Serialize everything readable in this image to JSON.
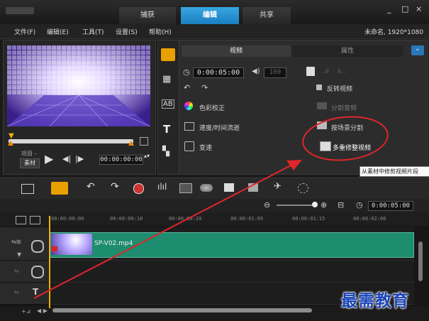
{
  "tabs": {
    "capture": "捕获",
    "edit": "编辑",
    "share": "共享"
  },
  "window_controls": {
    "minimize": "_",
    "maximize": "□",
    "close": "×"
  },
  "menu": [
    "文件(F)",
    "编辑(E)",
    "工具(T)",
    "设置(S)",
    "帮助(H)"
  ],
  "project_name": "未命名, 1920*1080",
  "preview": {
    "mode_project": "项目 -",
    "mode_clip": "素材",
    "timecode": "00:00:00:00"
  },
  "options_panel": {
    "tab_video": "视频",
    "tab_attribute": "属性",
    "duration": "0:00:05:00",
    "volume": "100",
    "items": {
      "color_correction": "色彩校正",
      "speed_time_lapse": "速度/时间流逝",
      "variable_speed": "变速",
      "reverse_video": "反转视频",
      "split_audio": "分割音频",
      "split_by_scene": "按场景分割",
      "multi_trim_video": "多重修整视频"
    },
    "tooltip": "从素材中修剪视频片段"
  },
  "timeline": {
    "zoom_timecode": "0:00:05:00",
    "ruler": [
      "00:00:00:00",
      "00:00:00:10",
      "00:00:00:20",
      "00:00:01:05",
      "00:00:01:15",
      "00:00:02:00"
    ],
    "clip_name": "SP-V02.mp4"
  },
  "watermark": "最需教育",
  "colors": {
    "accent": "#1f88cc",
    "clip": "#1e8c6e",
    "annotation": "#e0262a",
    "watermark": "#1a44b8"
  }
}
